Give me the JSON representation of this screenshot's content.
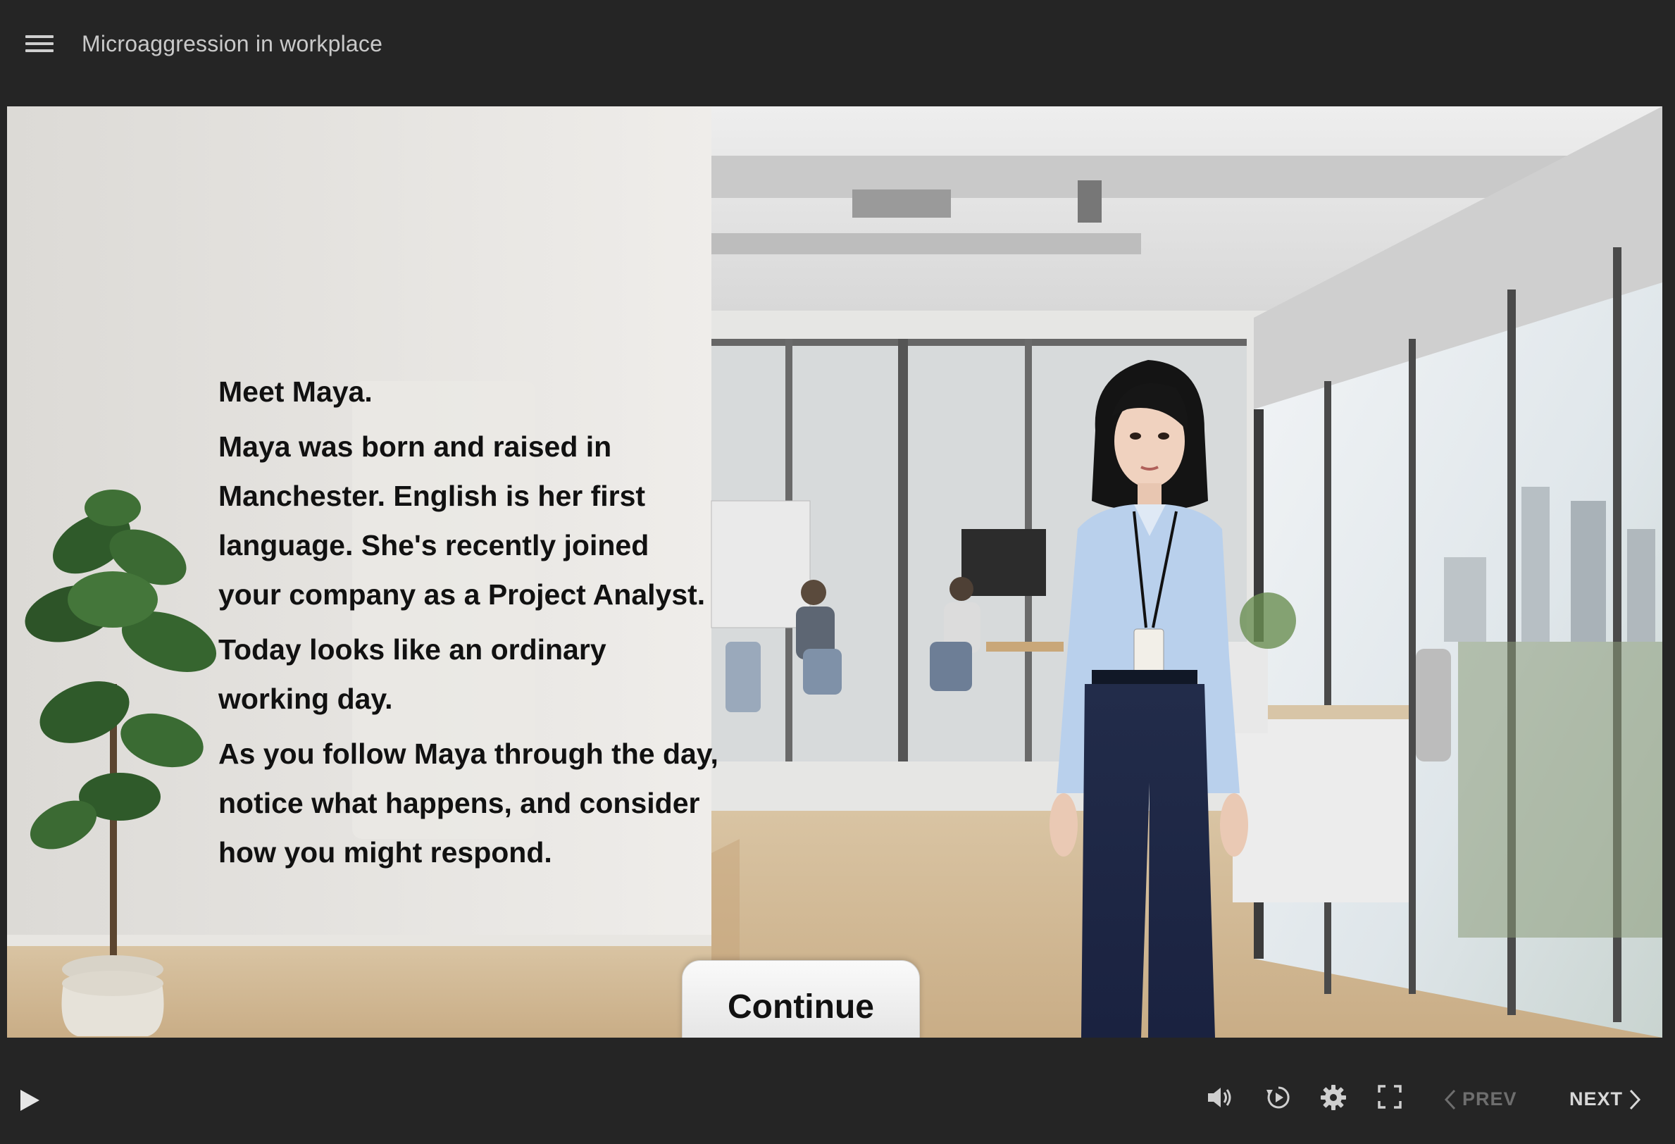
{
  "header": {
    "course_title": "Microaggression in workplace"
  },
  "narration": {
    "heading": "Meet Maya.",
    "paragraph_1": "Maya was born and raised in Manchester. English is her first language. She's recently joined your company as a Project Analyst.",
    "paragraph_2": "Today looks like an ordinary working day.",
    "paragraph_3": "As you follow Maya through the day, notice what happens, and consider how you might respond."
  },
  "continue_label": "Continue",
  "player": {
    "prev_label": "PREV",
    "next_label": "NEXT",
    "icons": [
      "play-icon",
      "volume-icon",
      "replay-icon",
      "gear-icon",
      "fullscreen-icon",
      "chevron-left-icon",
      "chevron-right-icon"
    ]
  },
  "colors": {
    "chrome_background": "#252525",
    "prev_disabled": "#6e6e6e",
    "next_enabled": "#d8d8d8"
  }
}
